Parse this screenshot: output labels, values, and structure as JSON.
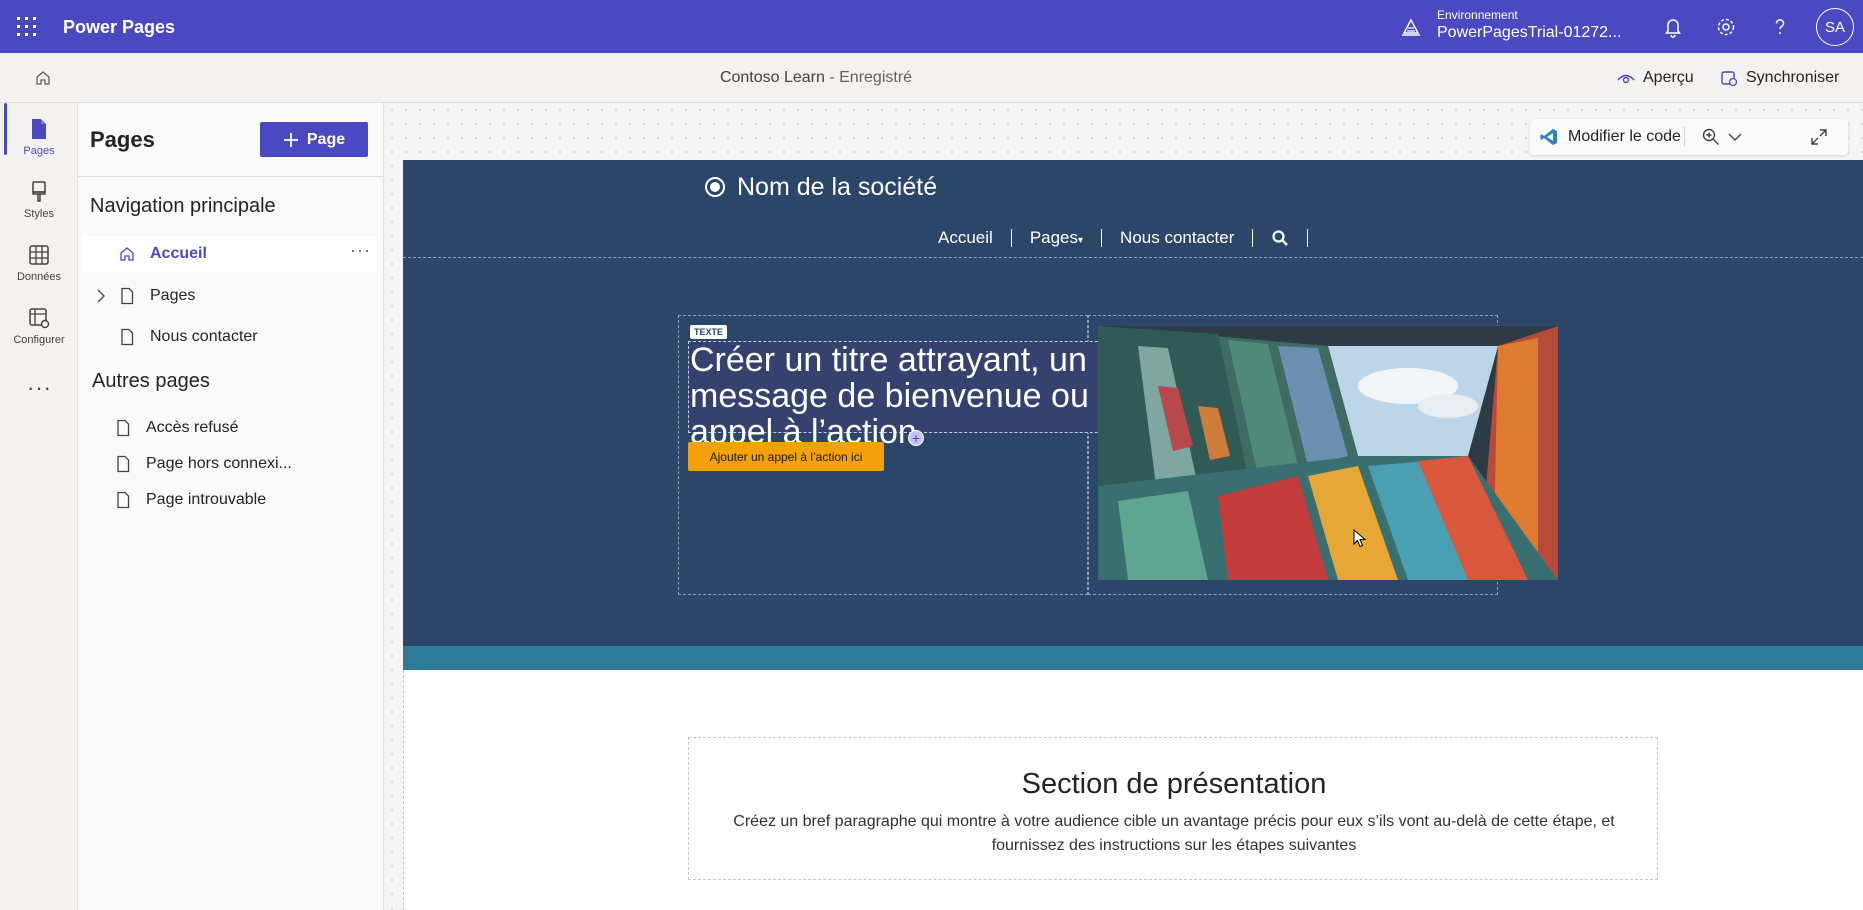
{
  "topbar": {
    "app_name": "Power Pages",
    "env_label": "Environnement",
    "env_value": "PowerPagesTrial-01272...",
    "avatar": "SA",
    "icons": [
      "waffle-icon",
      "environment-icon",
      "bell-icon",
      "gear-icon",
      "help-icon"
    ],
    "color": "#4b49c2"
  },
  "cmdbar": {
    "site_name": "Contoso Learn",
    "status": "- Enregistré",
    "preview": "Aperçu",
    "sync": "Synchroniser"
  },
  "rail": {
    "items": [
      {
        "label": "Pages",
        "icon": "page-icon",
        "active": true
      },
      {
        "label": "Styles",
        "icon": "brush-icon"
      },
      {
        "label": "Données",
        "icon": "table-icon"
      },
      {
        "label": "Configurer",
        "icon": "settings-table-icon"
      }
    ],
    "more": "···"
  },
  "pane": {
    "title": "Pages",
    "new_button": "Page",
    "main_nav_heading": "Navigation principale",
    "main_nav": [
      {
        "label": "Accueil",
        "icon": "home-icon",
        "selected": true
      },
      {
        "label": "Pages",
        "icon": "document-icon",
        "expandable": true
      },
      {
        "label": "Nous contacter",
        "icon": "document-icon"
      }
    ],
    "other_heading": "Autres pages",
    "other_pages": [
      {
        "label": "Accès refusé"
      },
      {
        "label": "Page hors connexi..."
      },
      {
        "label": "Page introuvable"
      }
    ],
    "more_actions": "···"
  },
  "canvas_toolbar": {
    "edit_code": "Modifier le code",
    "icons": [
      "vscode-icon",
      "zoom-icon",
      "chevron-down-icon",
      "expand-icon"
    ]
  },
  "site": {
    "company": "Nom de la société",
    "nav": [
      "Accueil",
      "Pages",
      "Nous contacter"
    ],
    "hero": {
      "tag": "TEXTE",
      "title": "Créer un titre attrayant, un message de bienvenue ou un appel à l’action",
      "cta": "Ajouter un appel à l’action ici"
    },
    "presentation": {
      "title": "Section de présentation",
      "text": "Créez un bref paragraphe qui montre à votre audience cible un avantage précis pour eux s’ils vont au-delà de cette étape, et fournissez des instructions sur les étapes suivantes"
    },
    "colors": {
      "header": "#2c4669",
      "band": "#2e7a99",
      "cta": "#f2a10b"
    }
  }
}
